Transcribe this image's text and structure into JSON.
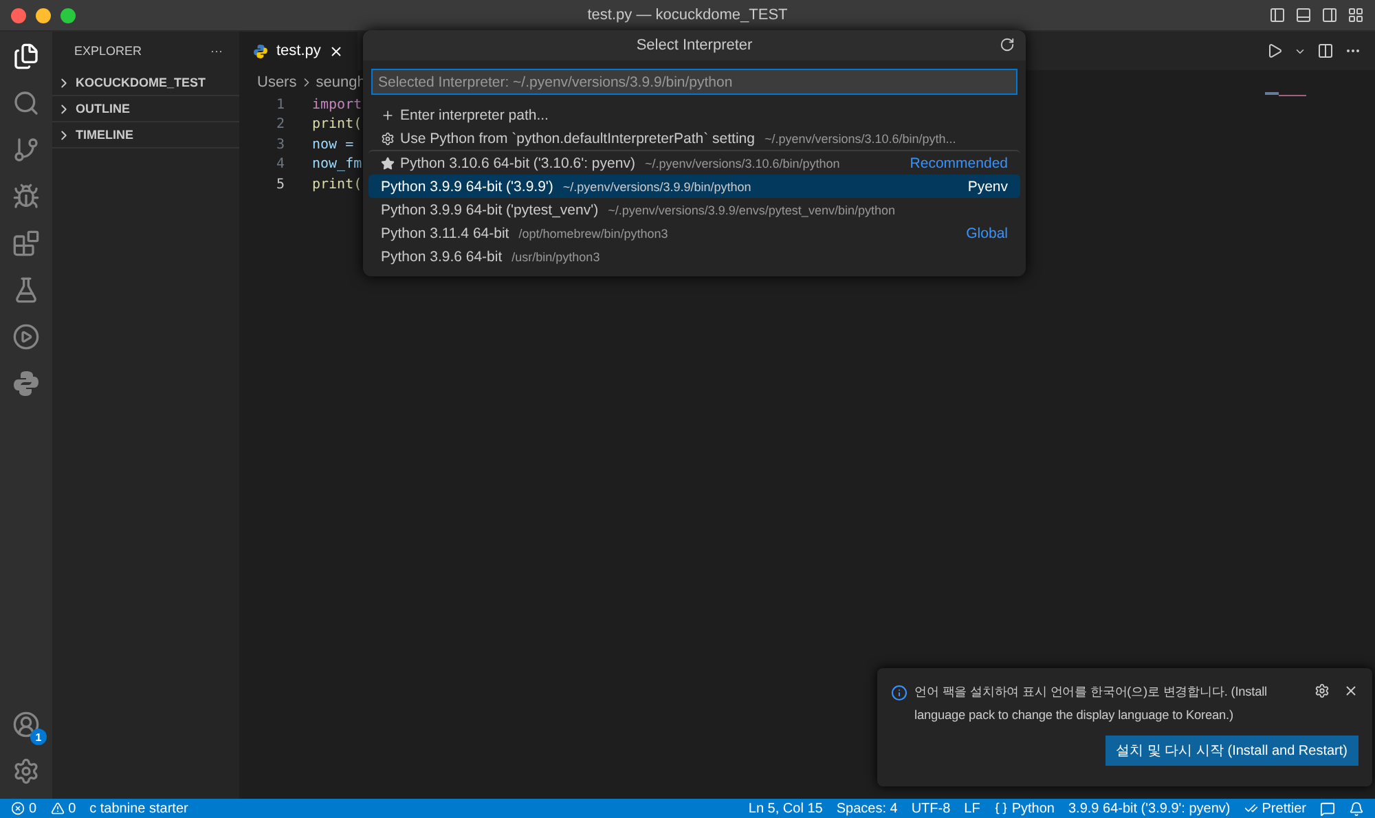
{
  "window": {
    "title": "test.py — kocuckdome_TEST"
  },
  "activity_bar": {
    "accounts_badge": "1"
  },
  "sidebar": {
    "header": "EXPLORER",
    "more": "···",
    "sections": [
      {
        "label": "KOCUCKDOME_TEST",
        "expanded": false
      },
      {
        "label": "OUTLINE",
        "expanded": false
      },
      {
        "label": "TIMELINE",
        "expanded": false
      }
    ]
  },
  "editor": {
    "tabs": [
      {
        "label": "test.py",
        "selected": true
      }
    ],
    "breadcrumb": [
      "Users",
      "seungh"
    ],
    "lines": [
      {
        "number": "1",
        "code": "import",
        "kind": "keyword",
        "current": false
      },
      {
        "number": "2",
        "code": "print(",
        "kind": "function",
        "current": false
      },
      {
        "number": "3",
        "code": "now = ",
        "kind": "variable",
        "current": false
      },
      {
        "number": "4",
        "code": "now_fm",
        "kind": "variable",
        "current": false
      },
      {
        "number": "5",
        "code": "print(",
        "kind": "function",
        "current": true
      }
    ]
  },
  "quick_pick": {
    "title": "Select Interpreter",
    "input": {
      "placeholder": "Selected Interpreter: ~/.pyenv/versions/3.9.9/bin/python"
    },
    "items": [
      {
        "kind": "enter_path",
        "label": "Enter interpreter path...",
        "selected": false
      },
      {
        "kind": "setting",
        "label": "Use Python from `python.defaultInterpreterPath` setting",
        "detail": "~/.pyenv/versions/3.10.6/bin/pyth...",
        "selected": false
      },
      {
        "kind": "recommended",
        "label": "Python 3.10.6 64-bit ('3.10.6': pyenv)",
        "detail": "~/.pyenv/versions/3.10.6/bin/python",
        "tag": "Recommended",
        "selected": false
      },
      {
        "kind": "interpreter",
        "label": "Python 3.9.9 64-bit ('3.9.9')",
        "detail": "~/.pyenv/versions/3.9.9/bin/python",
        "tag": "Pyenv",
        "selected": true
      },
      {
        "kind": "interpreter",
        "label": "Python 3.9.9 64-bit ('pytest_venv')",
        "detail": "~/.pyenv/versions/3.9.9/envs/pytest_venv/bin/python",
        "selected": false
      },
      {
        "kind": "interpreter",
        "label": "Python 3.11.4 64-bit",
        "detail": "/opt/homebrew/bin/python3",
        "tag": "Global",
        "selected": false
      },
      {
        "kind": "interpreter",
        "label": "Python 3.9.6 64-bit",
        "detail": "/usr/bin/python3",
        "selected": false
      }
    ]
  },
  "notification": {
    "message": "언어 팩을 설치하여 표시 언어를 한국어(으)로 변경합니다. (Install language pack to change the display language to Korean.)",
    "button": "설치 및 다시 시작 (Install and Restart)"
  },
  "status_bar": {
    "left": [
      {
        "kind": "errors",
        "text": "0"
      },
      {
        "kind": "warnings",
        "text": "0"
      },
      {
        "kind": "text",
        "text": "c tabnine starter"
      }
    ],
    "right": [
      {
        "kind": "text",
        "text": "Ln 5, Col 15"
      },
      {
        "kind": "text",
        "text": "Spaces: 4"
      },
      {
        "kind": "text",
        "text": "UTF-8"
      },
      {
        "kind": "text",
        "text": "LF"
      },
      {
        "kind": "language",
        "text": "Python"
      },
      {
        "kind": "text",
        "text": "3.9.9 64-bit ('3.9.9': pyenv)"
      },
      {
        "kind": "formatter",
        "text": "Prettier"
      },
      {
        "kind": "feedback"
      },
      {
        "kind": "notifications"
      }
    ]
  }
}
